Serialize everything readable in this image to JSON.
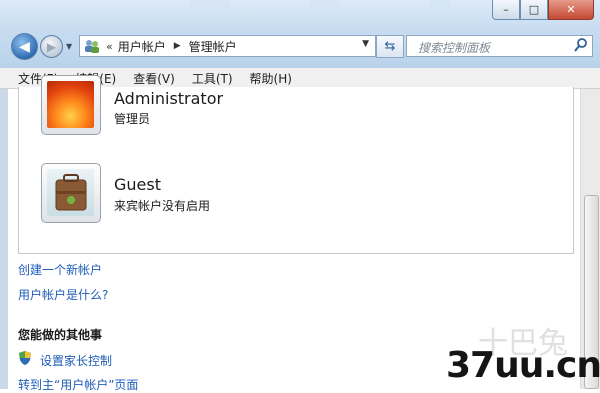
{
  "window": {
    "minimize_glyph": "–",
    "maximize_glyph": "□",
    "close_glyph": "✕"
  },
  "nav": {
    "back_glyph": "◀",
    "forward_glyph": "▶"
  },
  "address": {
    "overflow": "«",
    "crumbs": [
      "用户帐户",
      "管理帐户"
    ],
    "separator": "▶"
  },
  "search": {
    "placeholder": "搜索控制面板"
  },
  "menu": [
    "文件(F)",
    "编辑(E)",
    "查看(V)",
    "工具(T)",
    "帮助(H)"
  ],
  "accounts": [
    {
      "name": "Administrator",
      "desc": "管理员",
      "icon": "flower-icon"
    },
    {
      "name": "Guest",
      "desc": "来宾帐户没有启用",
      "icon": "briefcase-icon"
    }
  ],
  "links": {
    "create": "创建一个新帐户",
    "whatis": "用户帐户是什么?"
  },
  "other": {
    "heading": "您能做的其他事",
    "parental": "设置家长控制",
    "goto_partial": "转到主“用户帐户”页面"
  },
  "watermark": {
    "brand": "十巴兔",
    "site": "37uu.cn"
  },
  "colors": {
    "link": "#1f5cb9",
    "accent": "#2f6db3"
  }
}
